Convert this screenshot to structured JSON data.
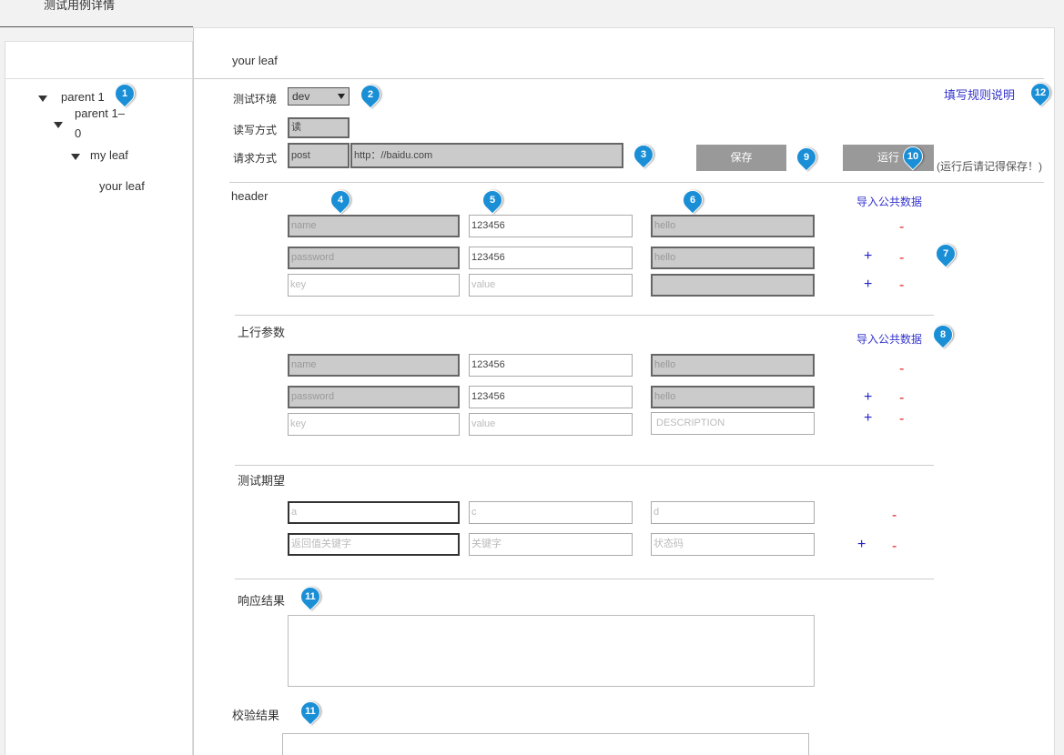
{
  "top_tab": "测试用例详情",
  "tree": {
    "parent1": "parent 1",
    "parent1_0_a": "parent 1–",
    "parent1_0_b": "0",
    "my_leaf": "my leaf",
    "your_leaf": "your leaf"
  },
  "main": {
    "title": "your leaf",
    "env_label": "测试环境",
    "env_value": "dev",
    "rw_label": "读写方式",
    "rw_value": "读",
    "req_label": "请求方式",
    "req_method": "post",
    "req_url": "http：//baidu.com",
    "save": "保存",
    "run": "运行",
    "run_note": "(运行后请记得保存！)",
    "rules_link": "填写规则说明"
  },
  "header_section": {
    "title": "header",
    "import": "导入公共数据",
    "rows": [
      {
        "key": "name",
        "value": "123456",
        "desc": "hello"
      },
      {
        "key": "password",
        "value": "123456",
        "desc": "hello"
      },
      {
        "key_ph": "key",
        "value_ph": "value"
      }
    ]
  },
  "params_section": {
    "title": "上行参数",
    "import": "导入公共数据",
    "rows": [
      {
        "key": "name",
        "value": "123456",
        "desc": "hello"
      },
      {
        "key": "password",
        "value": "123456",
        "desc": "hello"
      },
      {
        "key_ph": "key",
        "value_ph": "value",
        "desc_ph": "DESCRIPTION"
      }
    ]
  },
  "expect_section": {
    "title": "测试期望",
    "rows": [
      {
        "a": "a",
        "b": "c",
        "c": "d"
      },
      {
        "a": "返回值关键字",
        "b": "关键字",
        "c": "状态码"
      }
    ]
  },
  "response_section": {
    "title": "响应结果"
  },
  "verify_section": {
    "title": "校验结果"
  },
  "symbols": {
    "plus": "+",
    "minus": "-"
  },
  "markers": [
    "1",
    "2",
    "3",
    "4",
    "5",
    "6",
    "7",
    "8",
    "9",
    "10",
    "11",
    "11",
    "12"
  ],
  "colors": {
    "marker": "#1a8fd6",
    "plus": "#2222cc",
    "minus": "#dd2222",
    "link": "#3333cc",
    "button": "#999999"
  }
}
